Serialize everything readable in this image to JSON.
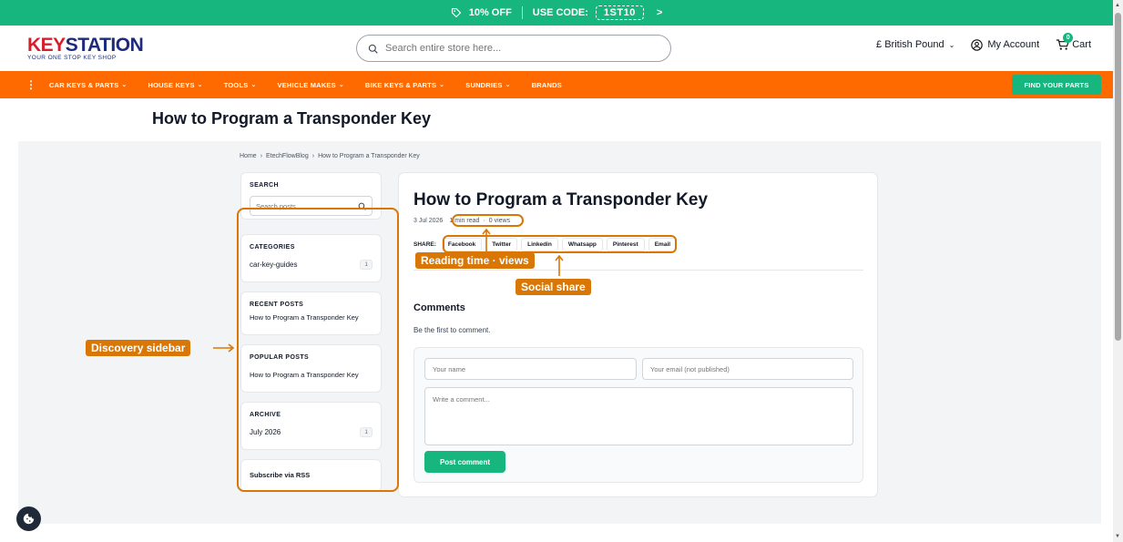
{
  "promo": {
    "discount": "10% OFF",
    "code_label": "USE CODE:",
    "code": "1ST10",
    "arrow": ">"
  },
  "header": {
    "logo_key": "KEY",
    "logo_station": "STATION",
    "logo_tagline": "YOUR ONE STOP KEY SHOP",
    "search_placeholder": "Search entire store here...",
    "currency": "£ British Pound",
    "account": "My Account",
    "cart_label": "Cart",
    "cart_count": "0"
  },
  "nav": {
    "items": [
      {
        "label": "CAR KEYS & PARTS"
      },
      {
        "label": "HOUSE KEYS"
      },
      {
        "label": "TOOLS"
      },
      {
        "label": "VEHICLE MAKES"
      },
      {
        "label": "BIKE KEYS & PARTS"
      },
      {
        "label": "SUNDRIES"
      },
      {
        "label": "BRANDS"
      }
    ],
    "find_parts": "FIND YOUR PARTS"
  },
  "page_title": "How to Program a Transponder Key",
  "breadcrumb": [
    "Home",
    "EtechFlowBlog",
    "How to Program a Transponder Key"
  ],
  "sidebar": {
    "search_title": "SEARCH",
    "search_placeholder": "Search posts...",
    "categories_title": "CATEGORIES",
    "category": "car-key-guides",
    "category_count": "1",
    "recent_title": "RECENT POSTS",
    "recent_item": "How to Program a Transponder Key",
    "popular_title": "POPULAR POSTS",
    "popular_item": "How to Program a Transponder Key",
    "archive_title": "ARCHIVE",
    "archive_item": "July 2026",
    "archive_count": "1",
    "rss": "Subscribe via RSS"
  },
  "article": {
    "title": "How to Program a Transponder Key",
    "date": "3 Jul 2026",
    "read_time": "1 min read",
    "views": "0 views",
    "share_label": "SHARE:",
    "share_buttons": [
      "Facebook",
      "Twitter",
      "Linkedin",
      "Whatsapp",
      "Pinterest",
      "Email"
    ],
    "comments_heading": "Comments",
    "first_comment": "Be the first to comment.",
    "name_placeholder": "Your name",
    "email_placeholder": "Your email (not published)",
    "comment_placeholder": "Write a comment...",
    "post_button": "Post comment"
  },
  "annotations": {
    "sidebar": "Discovery sidebar",
    "reading": "Reading time · views",
    "social": "Social share"
  },
  "colors": {
    "green": "#17b67f",
    "orange": "#ff6a00",
    "annotation": "#d97706"
  }
}
